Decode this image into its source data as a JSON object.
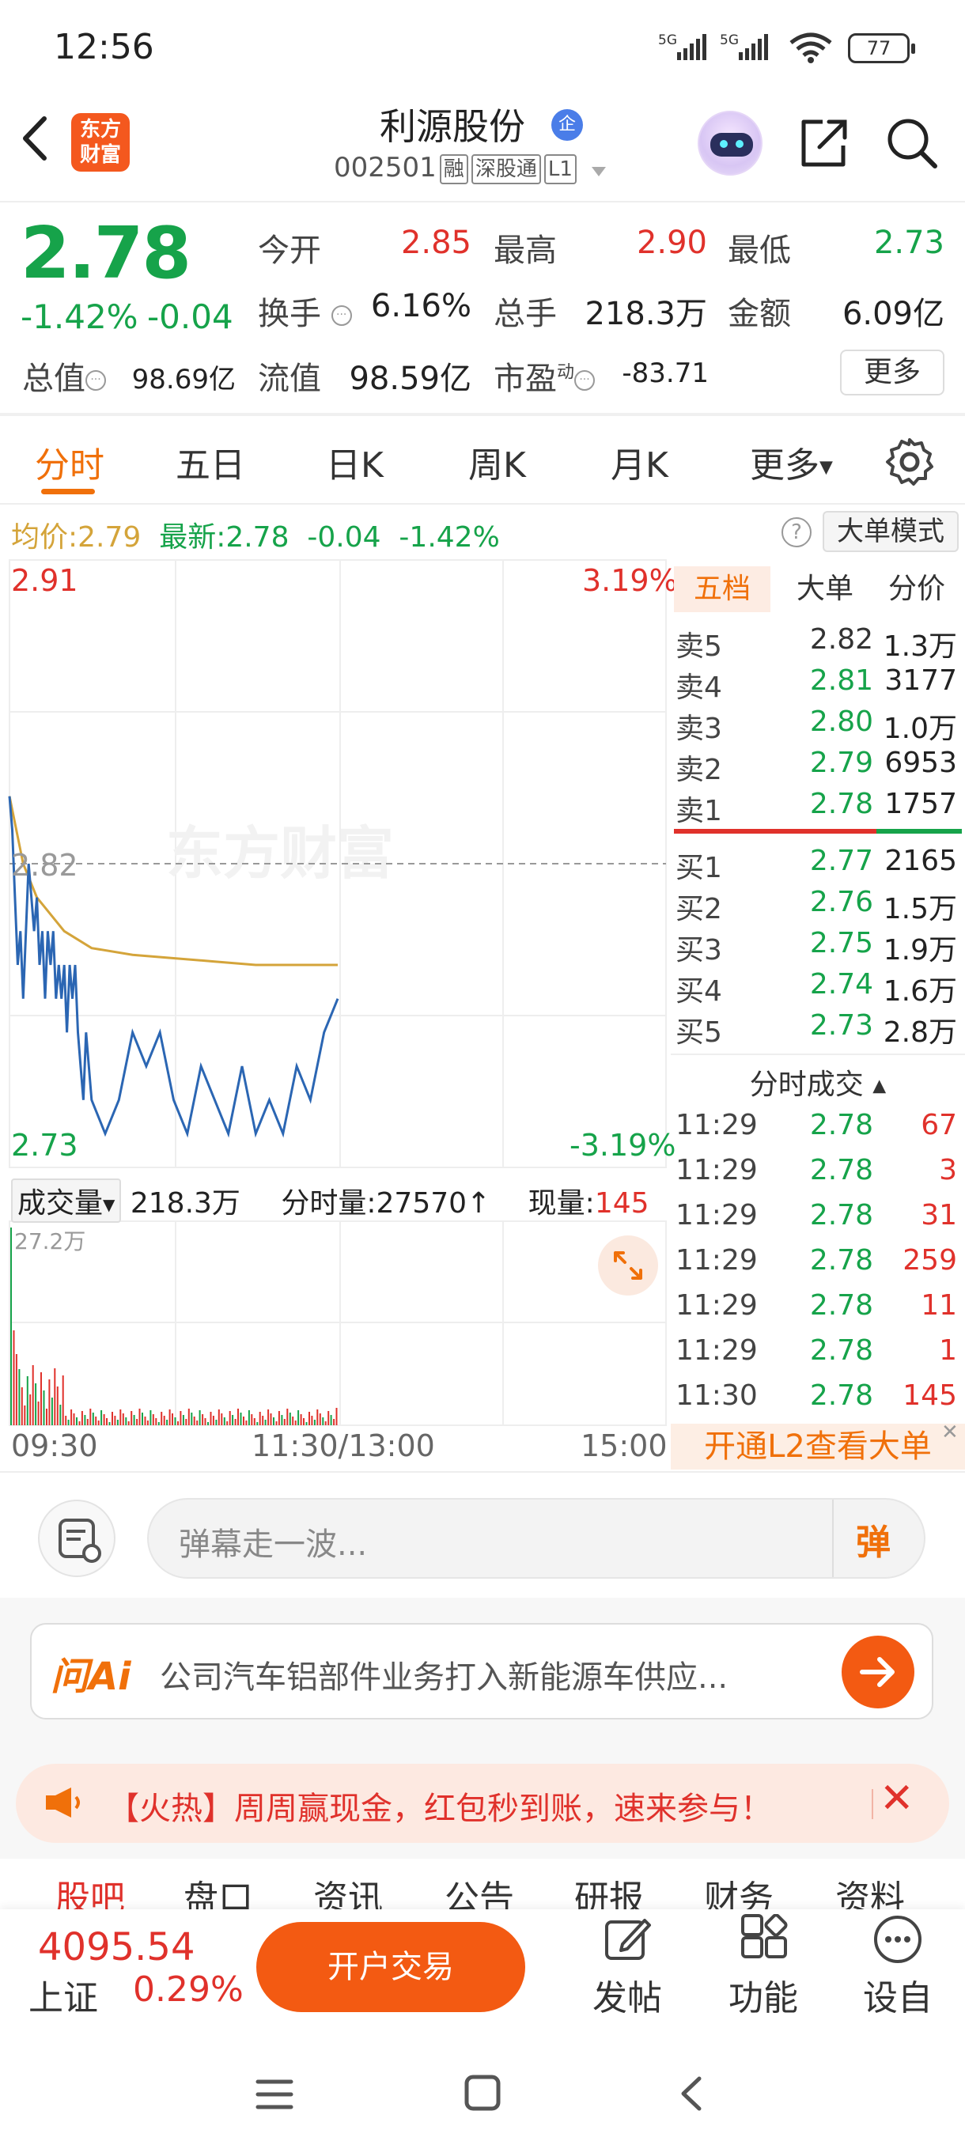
{
  "status": {
    "time": "12:56",
    "battery": "77",
    "net1": "5G",
    "net2": "5G"
  },
  "header": {
    "logo_line1": "东方",
    "logo_line2": "财富",
    "stock_name": "利源股份",
    "qi_badge": "企",
    "code": "002501",
    "tags": [
      "融",
      "深股通",
      "L1"
    ]
  },
  "quote": {
    "price": "2.78",
    "change_pct": "-1.42%",
    "change_abs": "-0.04",
    "open_label": "今开",
    "open": "2.85",
    "high_label": "最高",
    "high": "2.90",
    "low_label": "最低",
    "low": "2.73",
    "turnover_label": "换手",
    "turnover": "6.16%",
    "volume_label": "总手",
    "volume": "218.3万",
    "amount_label": "金额",
    "amount": "6.09亿",
    "mktcap_label": "总值",
    "mktcap": "98.69亿",
    "float_label": "流值",
    "float": "98.59亿",
    "pe_label": "市盈",
    "pe_sup": "动",
    "pe": "-83.71",
    "more": "更多"
  },
  "tabs": [
    "分时",
    "五日",
    "日K",
    "周K",
    "月K",
    "更多"
  ],
  "info_row": {
    "avg_label": "均价:",
    "avg": "2.79",
    "latest_label": "最新:",
    "latest": "2.78",
    "chg": "-0.04",
    "pct": "-1.42%",
    "help": "?",
    "mode_btn": "大单模式"
  },
  "chart": {
    "price_high": "2.91",
    "pct_high": "3.19%",
    "price_ref": "2.82",
    "price_low": "2.73",
    "pct_low": "-3.19%",
    "watermark": "东方财富",
    "vol_label": "成交量",
    "vol_total": "218.3万",
    "seg_label": "分时量:",
    "seg_value": "27570",
    "now_label": "现量:",
    "now_value": "145",
    "vol_scale": "27.2万",
    "time_start": "09:30",
    "time_mid": "11:30/13:00",
    "time_end": "15:00"
  },
  "chart_data": {
    "type": "line",
    "title": "",
    "ylim": [
      2.73,
      2.91
    ],
    "reference_price": 2.82,
    "x_range": [
      "09:30",
      "15:00"
    ],
    "series": [
      {
        "name": "",
        "color": "#2b66b3",
        "x": [
          "09:30",
          "09:31",
          "09:32",
          "09:33",
          "09:34",
          "09:35",
          "09:36",
          "09:37",
          "09:38",
          "09:39",
          "09:40",
          "09:41",
          "09:42",
          "09:43",
          "09:44",
          "09:45",
          "09:46",
          "09:47",
          "09:48",
          "09:49",
          "09:50",
          "09:51",
          "09:52",
          "09:53",
          "09:54",
          "09:55",
          "09:56",
          "09:57",
          "09:58",
          "09:59",
          "10:00",
          "10:05",
          "10:10",
          "10:15",
          "10:20",
          "10:25",
          "10:30",
          "10:35",
          "10:40",
          "10:45",
          "10:50",
          "10:55",
          "11:00",
          "11:05",
          "11:10",
          "11:15",
          "11:20",
          "11:25",
          "11:30"
        ],
        "values": [
          2.84,
          2.83,
          2.81,
          2.79,
          2.8,
          2.78,
          2.8,
          2.82,
          2.81,
          2.8,
          2.81,
          2.79,
          2.8,
          2.78,
          2.8,
          2.79,
          2.8,
          2.78,
          2.79,
          2.78,
          2.79,
          2.77,
          2.79,
          2.78,
          2.79,
          2.77,
          2.76,
          2.75,
          2.77,
          2.76,
          2.75,
          2.74,
          2.75,
          2.77,
          2.76,
          2.77,
          2.75,
          2.74,
          2.76,
          2.75,
          2.74,
          2.76,
          2.74,
          2.75,
          2.74,
          2.76,
          2.75,
          2.77,
          2.78
        ]
      },
      {
        "name": "均价",
        "color": "#d4a43a",
        "x": [
          "09:30",
          "09:35",
          "09:40",
          "09:50",
          "10:00",
          "10:15",
          "10:30",
          "10:45",
          "11:00",
          "11:15",
          "11:30"
        ],
        "values": [
          2.84,
          2.82,
          2.81,
          2.8,
          2.795,
          2.793,
          2.792,
          2.791,
          2.79,
          2.79,
          2.79
        ]
      }
    ],
    "volume": {
      "ymax_label": "27.2万",
      "latest": 145
    }
  },
  "orderbook": {
    "tabs": [
      "五档",
      "大单",
      "分价"
    ],
    "asks": [
      {
        "label": "卖5",
        "price": "2.82",
        "vol": "1.3万"
      },
      {
        "label": "卖4",
        "price": "2.81",
        "vol": "3177"
      },
      {
        "label": "卖3",
        "price": "2.80",
        "vol": "1.0万"
      },
      {
        "label": "卖2",
        "price": "2.79",
        "vol": "6953"
      },
      {
        "label": "卖1",
        "price": "2.78",
        "vol": "1757"
      }
    ],
    "bids": [
      {
        "label": "买1",
        "price": "2.77",
        "vol": "2165"
      },
      {
        "label": "买2",
        "price": "2.76",
        "vol": "1.5万"
      },
      {
        "label": "买3",
        "price": "2.75",
        "vol": "1.9万"
      },
      {
        "label": "买4",
        "price": "2.74",
        "vol": "1.6万"
      },
      {
        "label": "买5",
        "price": "2.73",
        "vol": "2.8万"
      }
    ],
    "trades_title": "分时成交",
    "trades": [
      {
        "time": "11:29",
        "price": "2.78",
        "vol": "67",
        "color": "#e0312b"
      },
      {
        "time": "11:29",
        "price": "2.78",
        "vol": "3",
        "color": "#e0312b"
      },
      {
        "time": "11:29",
        "price": "2.78",
        "vol": "31",
        "color": "#e0312b"
      },
      {
        "time": "11:29",
        "price": "2.78",
        "vol": "259",
        "color": "#e0312b"
      },
      {
        "time": "11:29",
        "price": "2.78",
        "vol": "11",
        "color": "#e0312b"
      },
      {
        "time": "11:29",
        "price": "2.78",
        "vol": "1",
        "color": "#e0312b"
      },
      {
        "time": "11:30",
        "price": "2.78",
        "vol": "145",
        "color": "#e0312b"
      }
    ],
    "l2_banner": "开通L2查看大单"
  },
  "danmaku": {
    "placeholder": "弹幕走一波...",
    "send": "弹"
  },
  "ai": {
    "logo": "问Ai",
    "text": "公司汽车铝部件业务打入新能源车供应..."
  },
  "promo": {
    "text": "【火热】周周赢现金，红包秒到账，速来参与！"
  },
  "subtabs": [
    "股吧",
    "盘口",
    "资讯",
    "公告",
    "研报",
    "财务",
    "资料"
  ],
  "bottom": {
    "index_value": "4095.54",
    "index_name": "上证",
    "index_pct": "0.29%",
    "open_account": "开户交易",
    "post": "发帖",
    "func": "功能",
    "watch": "设自选"
  }
}
